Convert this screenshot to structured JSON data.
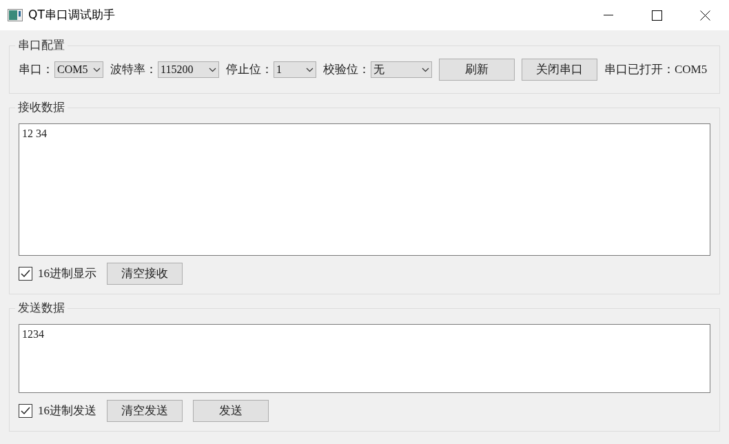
{
  "window": {
    "title": "QT串口调试助手"
  },
  "config": {
    "title": "串口配置",
    "fields": [
      {
        "label": "串口：",
        "value": "COM5"
      },
      {
        "label": "波特率：",
        "value": "115200"
      },
      {
        "label": "停止位：",
        "value": "1"
      },
      {
        "label": "校验位：",
        "value": "无"
      }
    ],
    "buttons": [
      "刷新",
      "关闭串口"
    ],
    "status": "串口已打开：COM5"
  },
  "receive": {
    "title": "接收数据",
    "text": "12 34",
    "hex": {
      "label": "16进制显示",
      "checked": true
    },
    "buttons": [
      "清空接收"
    ]
  },
  "send": {
    "title": "发送数据",
    "text": "1234",
    "hex": {
      "label": "16进制发送",
      "checked": true
    },
    "buttons": [
      "清空发送",
      "发送"
    ]
  }
}
